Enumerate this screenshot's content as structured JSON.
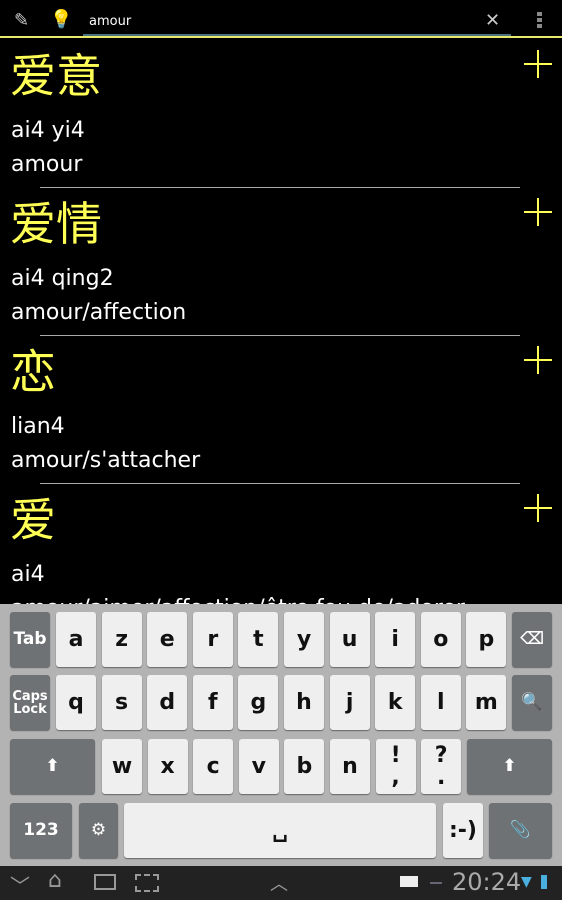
{
  "toolbar": {
    "search_value": "amour",
    "icons": [
      "pencil-icon",
      "lightbulb-icon",
      "clear-icon",
      "overflow-menu-icon"
    ]
  },
  "entries": [
    {
      "hanzi": "爱意",
      "pinyin": "ai4 yi4",
      "translation": "amour"
    },
    {
      "hanzi": "爱情",
      "pinyin": "ai4 qing2",
      "translation": "amour/affection"
    },
    {
      "hanzi": "恋",
      "pinyin": "lian4",
      "translation": "amour/s'attacher"
    },
    {
      "hanzi": "爱",
      "pinyin": "ai4",
      "translation": "amour/aimer/affection/être fou de/adorer"
    }
  ],
  "keyboard": {
    "row1": [
      "Tab",
      "a",
      "z",
      "e",
      "r",
      "t",
      "y",
      "u",
      "i",
      "o",
      "p",
      "⌫"
    ],
    "row2": [
      "Caps Lock",
      "q",
      "s",
      "d",
      "f",
      "g",
      "h",
      "j",
      "k",
      "l",
      "m",
      "🔍"
    ],
    "row3": [
      "⬆",
      "w",
      "x",
      "c",
      "v",
      "b",
      "n",
      "!\n,",
      "?\n.",
      "⬆"
    ],
    "row4": [
      "123",
      "⚙",
      "␣",
      ":-)",
      "📎"
    ]
  },
  "status": {
    "time": "20:24"
  },
  "colors": {
    "accent": "#ffff55",
    "background": "#000000"
  }
}
